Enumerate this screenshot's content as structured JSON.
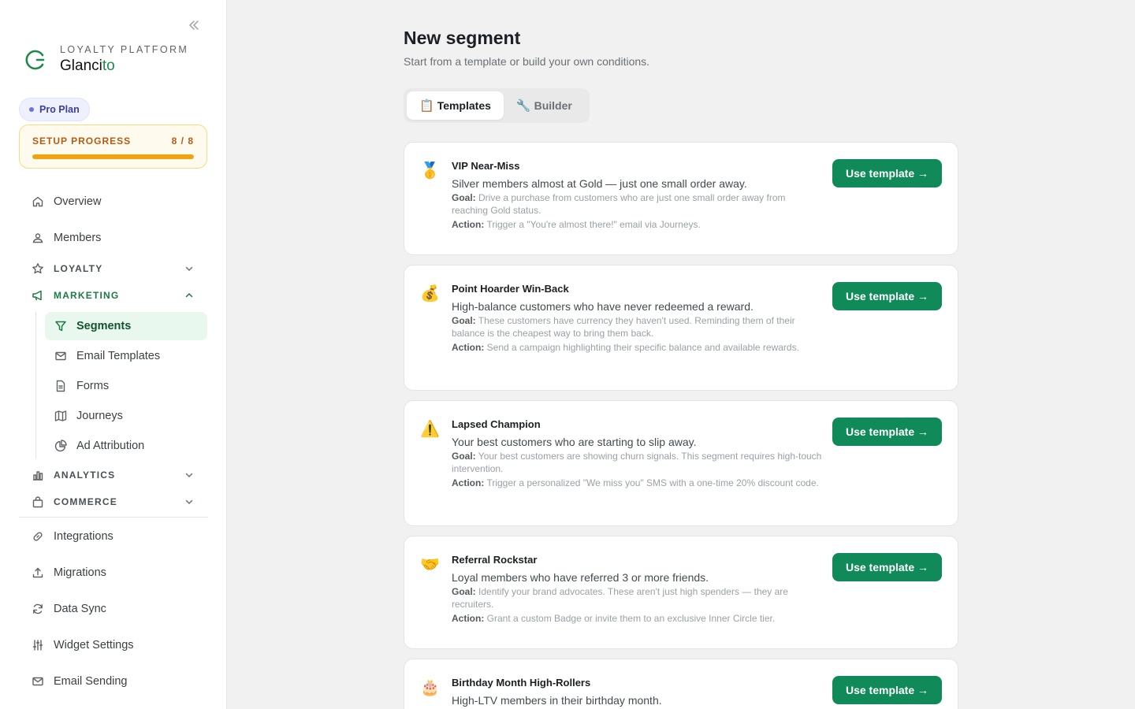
{
  "brand": {
    "subtitle": "LOYALTY PLATFORM",
    "name_main": "Glanci",
    "name_accent": "to",
    "accent_color": "#1f8a4c"
  },
  "plan_badge": "Pro Plan",
  "setup": {
    "label": "SETUP PROGRESS",
    "count": "8 / 8",
    "progress_percent": 100
  },
  "nav": {
    "overview": "Overview",
    "members": "Members",
    "loyalty": "LOYALTY",
    "marketing": "MARKETING",
    "segments": "Segments",
    "email_templates": "Email Templates",
    "forms": "Forms",
    "journeys": "Journeys",
    "ad_attribution": "Ad Attribution",
    "analytics": "ANALYTICS",
    "commerce": "COMMERCE",
    "integrations": "Integrations",
    "migrations": "Migrations",
    "data_sync": "Data Sync",
    "widget_settings": "Widget Settings",
    "email_sending": "Email Sending"
  },
  "page": {
    "title": "New segment",
    "subtitle": "Start from a template or build your own conditions."
  },
  "tabs": {
    "templates_emoji": "📋",
    "templates": "Templates",
    "builder_emoji": "🔧",
    "builder": "Builder"
  },
  "labels": {
    "goal": "Goal:",
    "action": "Action:",
    "use_template": "Use template →"
  },
  "templates": [
    {
      "emoji": "🥇",
      "name": "VIP Near-Miss",
      "description": "Silver members almost at Gold — just one small order away.",
      "goal": "Drive a purchase from customers who are just one small order away from reaching Gold status.",
      "action": "Trigger a \"You're almost there!\" email via Journeys."
    },
    {
      "emoji": "💰",
      "name": "Point Hoarder Win-Back",
      "description": "High-balance customers who have never redeemed a reward.",
      "goal": "These customers have currency they haven't used. Reminding them of their balance is the cheapest way to bring them back.",
      "action": "Send a campaign highlighting their specific balance and available rewards."
    },
    {
      "emoji": "⚠️",
      "name": "Lapsed Champion",
      "description": "Your best customers who are starting to slip away.",
      "goal": "Your best customers are showing churn signals. This segment requires high-touch intervention.",
      "action": "Trigger a personalized \"We miss you\" SMS with a one-time 20% discount code."
    },
    {
      "emoji": "🤝",
      "name": "Referral Rockstar",
      "description": "Loyal members who have referred 3 or more friends.",
      "goal": "Identify your brand advocates. These aren't just high spenders — they are recruiters.",
      "action": "Grant a custom Badge or invite them to an exclusive Inner Circle tier."
    },
    {
      "emoji": "🎂",
      "name": "Birthday Month High-Rollers",
      "description": "High-LTV members in their birthday month."
    }
  ]
}
